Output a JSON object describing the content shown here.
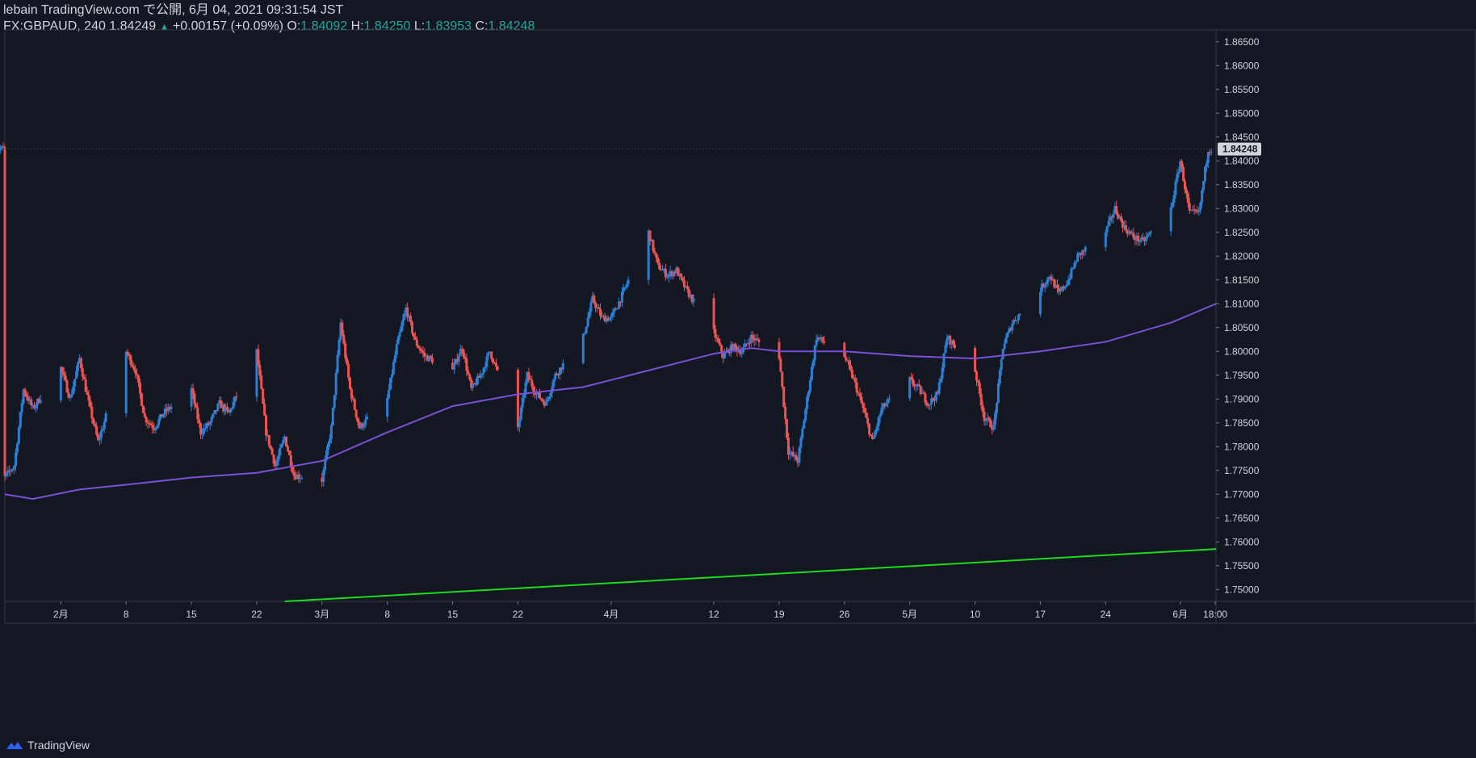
{
  "header": {
    "line1": "lebain TradingView.com で公開, 6月 04, 2021 09:31:54 JST",
    "symbol_info": "FX:GBPAUD, 240 1.84249",
    "arrow": "▲",
    "change": "+0.00157 (+0.09%)",
    "o_label": "O:",
    "o_value": "1.84092",
    "h_label": "H:",
    "h_value": "1.84250",
    "l_label": "L:",
    "l_value": "1.83953",
    "c_label": "C:",
    "c_value": "1.84248"
  },
  "footer": {
    "brand": "TradingView",
    "logo_icon": "tradingview-logo-icon"
  },
  "colors": {
    "background": "#131722",
    "bull": "#2a7fd4",
    "bear": "#ef5350",
    "ma": "#7b4fd6",
    "trendline": "#1ddc1d",
    "axis_text": "#d1d4dc",
    "price_label_bg": "#d1d4dc"
  },
  "chart_data": {
    "type": "candlestick",
    "symbol": "FX:GBPAUD",
    "interval": "240",
    "y_axis": {
      "ticks": [
        "1.86500",
        "1.86000",
        "1.85500",
        "1.85000",
        "1.84500",
        "1.84000",
        "1.83500",
        "1.83000",
        "1.82500",
        "1.82000",
        "1.81500",
        "1.81000",
        "1.80500",
        "1.80000",
        "1.79500",
        "1.79000",
        "1.78500",
        "1.78000",
        "1.77500",
        "1.77000",
        "1.76500",
        "1.76000",
        "1.75500",
        "1.75000"
      ],
      "range": [
        1.7475,
        1.8675
      ],
      "last_price_label": "1.84248"
    },
    "x_axis": {
      "ticks": [
        "2月",
        "8",
        "15",
        "22",
        "3月",
        "8",
        "15",
        "22",
        "4月",
        "12",
        "19",
        "26",
        "5月",
        "10",
        "17",
        "24",
        "6月",
        "18:00"
      ],
      "range": [
        "2021-01-26",
        "2021-06-04T20:00"
      ]
    },
    "close_path": [
      [
        "2021-01-26",
        1.7735
      ],
      [
        "2021-01-27",
        1.776
      ],
      [
        "2021-01-28",
        1.792
      ],
      [
        "2021-01-29",
        1.788
      ],
      [
        "2021-02-01",
        1.7965
      ],
      [
        "2021-02-02",
        1.79
      ],
      [
        "2021-02-03",
        1.7985
      ],
      [
        "2021-02-04",
        1.789
      ],
      [
        "2021-02-05",
        1.781
      ],
      [
        "2021-02-08",
        1.8
      ],
      [
        "2021-02-09",
        1.796
      ],
      [
        "2021-02-10",
        1.786
      ],
      [
        "2021-02-11",
        1.784
      ],
      [
        "2021-02-12",
        1.787
      ],
      [
        "2021-02-15",
        1.792
      ],
      [
        "2021-02-16",
        1.783
      ],
      [
        "2021-02-17",
        1.785
      ],
      [
        "2021-02-18",
        1.789
      ],
      [
        "2021-02-19",
        1.787
      ],
      [
        "2021-02-22",
        1.8
      ],
      [
        "2021-02-23",
        1.783
      ],
      [
        "2021-02-24",
        1.776
      ],
      [
        "2021-02-25",
        1.782
      ],
      [
        "2021-02-26",
        1.774
      ],
      [
        "2021-03-01",
        1.773
      ],
      [
        "2021-03-02",
        1.784
      ],
      [
        "2021-03-03",
        1.806
      ],
      [
        "2021-03-04",
        1.792
      ],
      [
        "2021-03-05",
        1.784
      ],
      [
        "2021-03-08",
        1.79
      ],
      [
        "2021-03-09",
        1.801
      ],
      [
        "2021-03-10",
        1.809
      ],
      [
        "2021-03-11",
        1.802
      ],
      [
        "2021-03-12",
        1.799
      ],
      [
        "2021-03-15",
        1.796
      ],
      [
        "2021-03-16",
        1.801
      ],
      [
        "2021-03-17",
        1.792
      ],
      [
        "2021-03-18",
        1.795
      ],
      [
        "2021-03-19",
        1.8
      ],
      [
        "2021-03-22",
        1.784
      ],
      [
        "2021-03-23",
        1.795
      ],
      [
        "2021-03-24",
        1.791
      ],
      [
        "2021-03-25",
        1.789
      ],
      [
        "2021-03-26",
        1.795
      ],
      [
        "2021-03-29",
        1.803
      ],
      [
        "2021-03-30",
        1.811
      ],
      [
        "2021-03-31",
        1.807
      ],
      [
        "2021-04-01",
        1.807
      ],
      [
        "2021-04-02",
        1.811
      ],
      [
        "2021-04-05",
        1.825
      ],
      [
        "2021-04-06",
        1.818
      ],
      [
        "2021-04-07",
        1.816
      ],
      [
        "2021-04-08",
        1.817
      ],
      [
        "2021-04-09",
        1.813
      ],
      [
        "2021-04-12",
        1.804
      ],
      [
        "2021-04-13",
        1.799
      ],
      [
        "2021-04-14",
        1.801
      ],
      [
        "2021-04-15",
        1.8
      ],
      [
        "2021-04-16",
        1.803
      ],
      [
        "2021-04-19",
        1.799
      ],
      [
        "2021-04-20",
        1.779
      ],
      [
        "2021-04-21",
        1.777
      ],
      [
        "2021-04-22",
        1.79
      ],
      [
        "2021-04-23",
        1.803
      ],
      [
        "2021-04-26",
        1.799
      ],
      [
        "2021-04-27",
        1.794
      ],
      [
        "2021-04-28",
        1.788
      ],
      [
        "2021-04-29",
        1.781
      ],
      [
        "2021-04-30",
        1.788
      ],
      [
        "2021-05-03",
        1.794
      ],
      [
        "2021-05-04",
        1.792
      ],
      [
        "2021-05-05",
        1.789
      ],
      [
        "2021-05-06",
        1.791
      ],
      [
        "2021-05-07",
        1.803
      ],
      [
        "2021-05-10",
        1.796
      ],
      [
        "2021-05-11",
        1.786
      ],
      [
        "2021-05-12",
        1.784
      ],
      [
        "2021-05-13",
        1.801
      ],
      [
        "2021-05-14",
        1.806
      ],
      [
        "2021-05-17",
        1.813
      ],
      [
        "2021-05-18",
        1.816
      ],
      [
        "2021-05-19",
        1.812
      ],
      [
        "2021-05-20",
        1.815
      ],
      [
        "2021-05-21",
        1.82
      ],
      [
        "2021-05-24",
        1.825
      ],
      [
        "2021-05-25",
        1.83
      ],
      [
        "2021-05-26",
        1.826
      ],
      [
        "2021-05-27",
        1.824
      ],
      [
        "2021-05-28",
        1.823
      ],
      [
        "2021-05-31",
        1.83
      ],
      [
        "2021-06-01",
        1.84
      ],
      [
        "2021-06-02",
        1.829
      ],
      [
        "2021-06-03",
        1.829
      ],
      [
        "2021-06-04",
        1.8425
      ]
    ],
    "moving_average": [
      [
        "2021-01-26",
        1.77
      ],
      [
        "2021-01-29",
        1.769
      ],
      [
        "2021-02-03",
        1.771
      ],
      [
        "2021-02-08",
        1.772
      ],
      [
        "2021-02-15",
        1.7735
      ],
      [
        "2021-02-22",
        1.7745
      ],
      [
        "2021-03-01",
        1.777
      ],
      [
        "2021-03-08",
        1.783
      ],
      [
        "2021-03-15",
        1.7885
      ],
      [
        "2021-03-22",
        1.791
      ],
      [
        "2021-03-29",
        1.7925
      ],
      [
        "2021-04-05",
        1.796
      ],
      [
        "2021-04-12",
        1.7995
      ],
      [
        "2021-04-16",
        1.8007
      ],
      [
        "2021-04-19",
        1.8
      ],
      [
        "2021-04-26",
        1.8
      ],
      [
        "2021-05-03",
        1.799
      ],
      [
        "2021-05-10",
        1.7985
      ],
      [
        "2021-05-17",
        1.8
      ],
      [
        "2021-05-24",
        1.802
      ],
      [
        "2021-05-31",
        1.806
      ],
      [
        "2021-06-04T20:00",
        1.81
      ]
    ],
    "trendline": [
      [
        "2021-02-25",
        1.7475
      ],
      [
        "2021-06-04T20:00",
        1.7585
      ]
    ],
    "last_price_line": 1.84248,
    "grid": false
  }
}
